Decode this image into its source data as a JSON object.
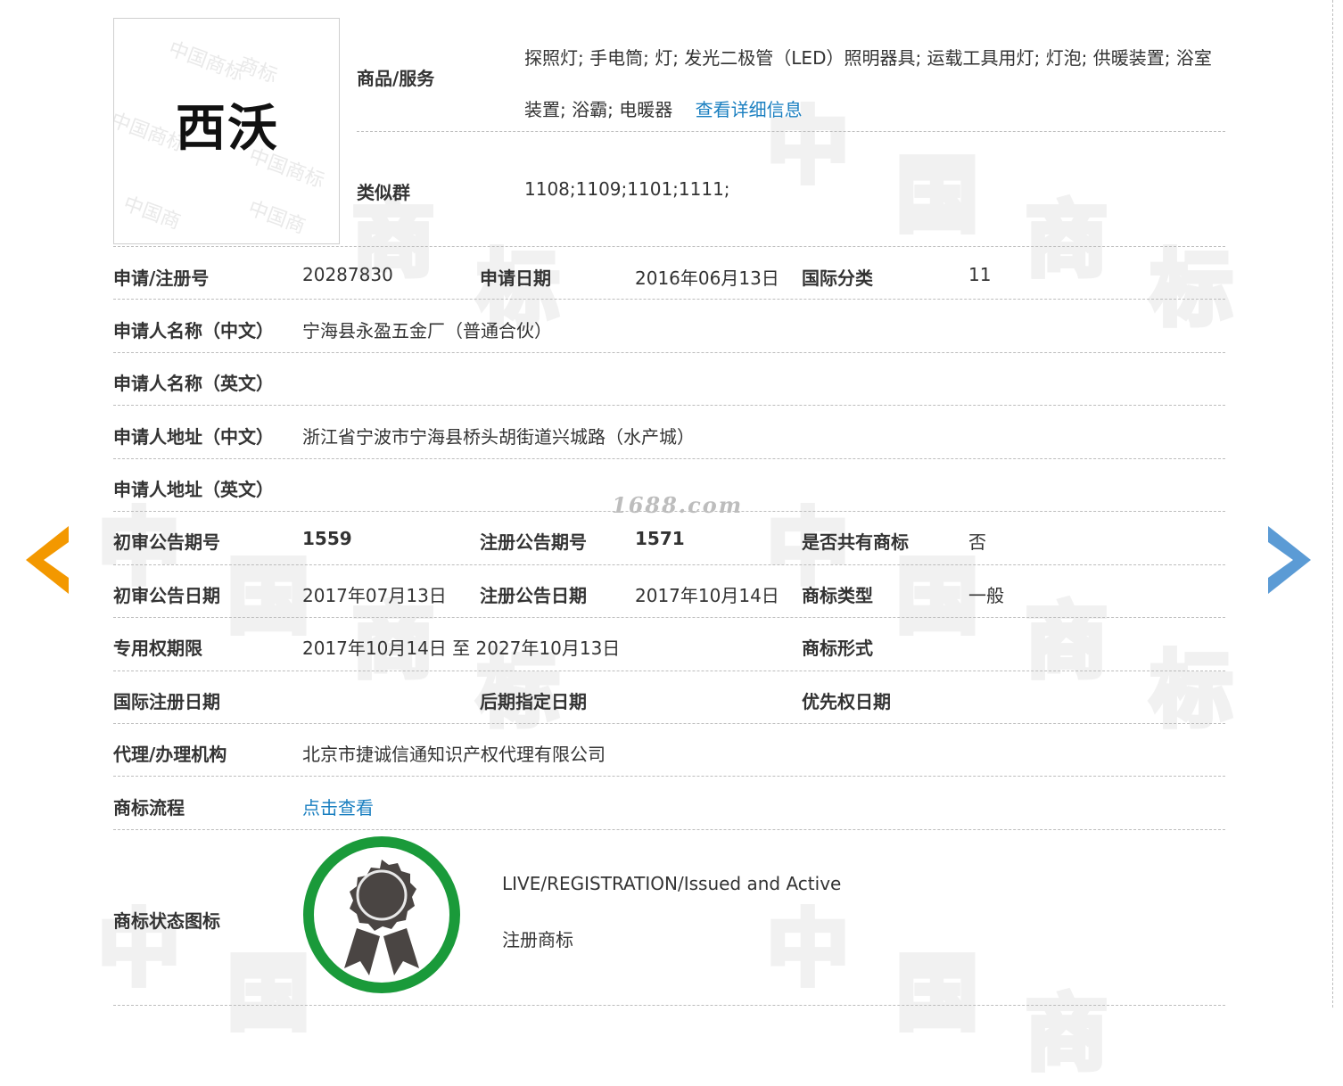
{
  "logo": {
    "text": "西沃"
  },
  "goods_services": {
    "label": "商品/服务",
    "text": "探照灯; 手电筒; 灯; 发光二极管（LED）照明器具; 运载工具用灯; 灯泡; 供暖装置; 浴室装置; 浴霸; 电暖器",
    "detail_link": "查看详细信息"
  },
  "similar_group": {
    "label": "类似群",
    "value": "1108;1109;1101;1111;"
  },
  "row_reg": {
    "reg_no_label": "申请/注册号",
    "reg_no": "20287830",
    "app_date_label": "申请日期",
    "app_date": "2016年06月13日",
    "intl_class_label": "国际分类",
    "intl_class": "11"
  },
  "applicant_cn": {
    "label": "申请人名称（中文）",
    "value": "宁海县永盈五金厂（普通合伙）"
  },
  "applicant_en": {
    "label": "申请人名称（英文）",
    "value": ""
  },
  "address_cn": {
    "label": "申请人地址（中文）",
    "value": "浙江省宁波市宁海县桥头胡街道兴城路（水产城）"
  },
  "address_en": {
    "label": "申请人地址（英文）",
    "value": ""
  },
  "row_issue": {
    "prelim_issue_label": "初审公告期号",
    "prelim_issue": "1559",
    "reg_issue_label": "注册公告期号",
    "reg_issue": "1571",
    "shared_label": "是否共有商标",
    "shared": "否"
  },
  "row_dates": {
    "prelim_date_label": "初审公告日期",
    "prelim_date": "2017年07月13日",
    "reg_date_label": "注册公告日期",
    "reg_date": "2017年10月14日",
    "type_label": "商标类型",
    "type": "一般"
  },
  "row_term": {
    "term_label": "专用权期限",
    "term": "2017年10月14日 至 2027年10月13日",
    "form_label": "商标形式",
    "form": ""
  },
  "row_intl": {
    "intl_reg_label": "国际注册日期",
    "intl_reg": "",
    "later_label": "后期指定日期",
    "later": "",
    "priority_label": "优先权日期",
    "priority": ""
  },
  "agent": {
    "label": "代理/办理机构",
    "value": "北京市捷诚信通知识产权代理有限公司"
  },
  "process": {
    "label": "商标流程",
    "link": "点击查看"
  },
  "status": {
    "label": "商标状态图标",
    "en": "LIVE/REGISTRATION/Issued and Active",
    "cn": "注册商标",
    "ring_color": "#1a9a3a",
    "icon": "award-ribbon-icon"
  },
  "watermark": {
    "site": "1688.com",
    "chars": [
      "中",
      "国",
      "商",
      "标"
    ]
  },
  "nav": {
    "prev_icon": "chevron-left-icon",
    "next_icon": "chevron-right-icon",
    "prev_color": "#f39800",
    "next_color": "#5b9bd5"
  }
}
